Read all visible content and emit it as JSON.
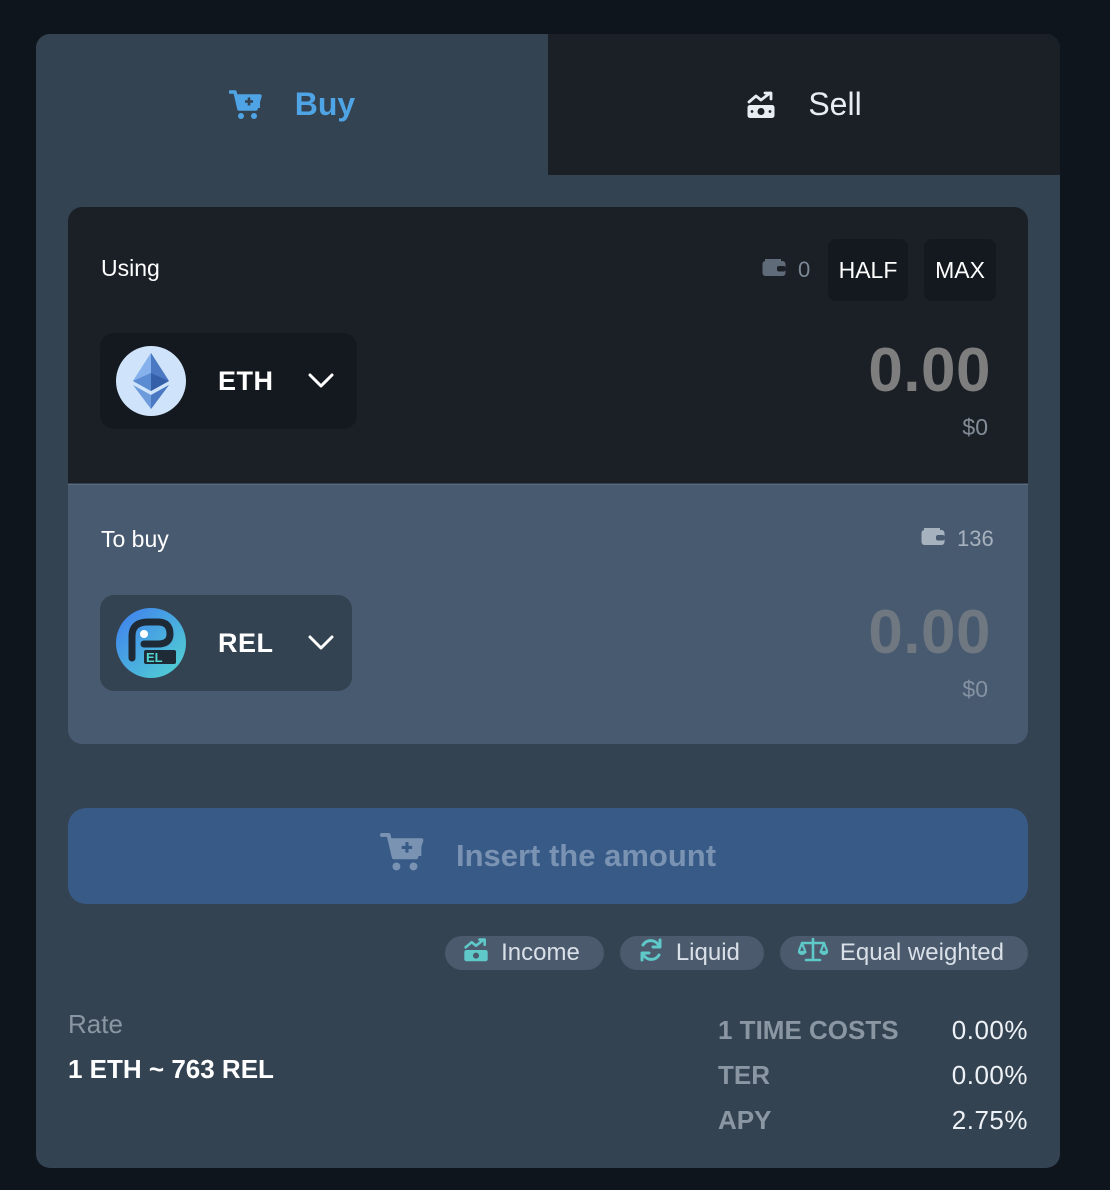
{
  "tabs": {
    "buy": {
      "label": "Buy",
      "icon": "cart-plus-icon",
      "active": true
    },
    "sell": {
      "label": "Sell",
      "icon": "money-chart-icon",
      "active": false
    }
  },
  "using": {
    "label": "Using",
    "balance": "0",
    "half_label": "HALF",
    "max_label": "MAX",
    "token": {
      "symbol": "ETH",
      "icon": "ethereum-logo"
    },
    "amount": "0.00",
    "usd": "$0"
  },
  "to_buy": {
    "label": "To buy",
    "balance": "136",
    "token": {
      "symbol": "REL",
      "icon": "rel-logo"
    },
    "amount": "0.00",
    "usd": "$0"
  },
  "cta": {
    "label": "Insert the amount",
    "icon": "cart-plus-icon",
    "disabled": true
  },
  "tags": [
    {
      "label": "Income",
      "icon": "money-chart-icon"
    },
    {
      "label": "Liquid",
      "icon": "refresh-icon"
    },
    {
      "label": "Equal weighted",
      "icon": "scale-icon"
    }
  ],
  "rate": {
    "label": "Rate",
    "value": "1 ETH ~ 763 REL"
  },
  "costs": [
    {
      "key": "1 TIME COSTS",
      "value": "0.00%"
    },
    {
      "key": "TER",
      "value": "0.00%"
    },
    {
      "key": "APY",
      "value": "2.75%"
    }
  ],
  "colors": {
    "accent": "#4ea4e4",
    "tag_icon": "#5fc8c8",
    "cta_bg": "#385a87"
  }
}
